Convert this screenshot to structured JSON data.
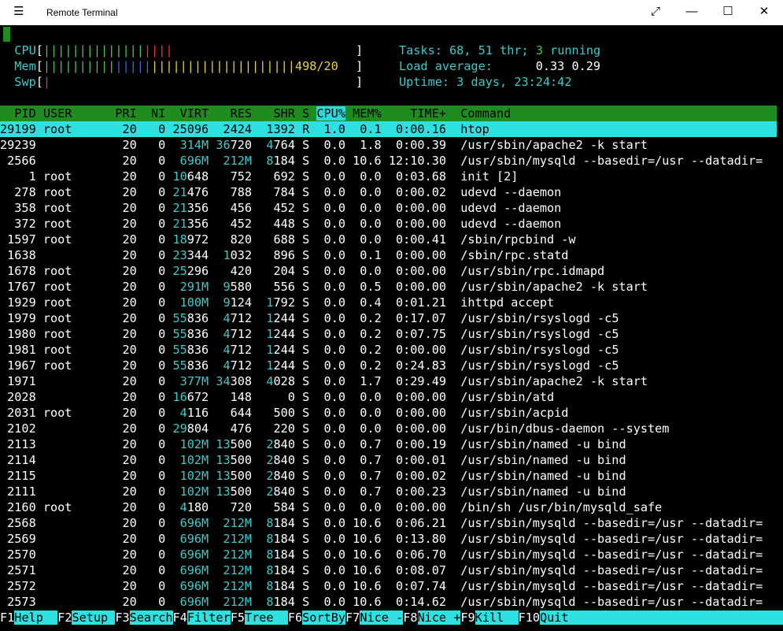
{
  "window": {
    "title": "Remote Terminal",
    "controls": [
      "⤢",
      "—",
      "☐",
      "✕"
    ]
  },
  "meters": {
    "cpu": {
      "label": "CPU",
      "green": "||||||||||||||",
      "red": "||||"
    },
    "mem": {
      "label": "Mem",
      "green": "||||||||||",
      "blue": "|||||",
      "yellow": "||||||||||||||||||||",
      "value": "498/20"
    },
    "swp": {
      "label": "Swp",
      "red": "|"
    }
  },
  "summary": {
    "tasks_label": "Tasks:",
    "tasks": "68,",
    "thr": "51",
    "thr_label": "thr;",
    "running": "3",
    "running_label": "running",
    "load_label": "Load average:",
    "load1": "0.33",
    "load5": "0.29",
    "uptime_label": "Uptime:",
    "uptime": "3 days, 23:24:42"
  },
  "columns": [
    "PID",
    "USER",
    "PRI",
    "NI",
    "VIRT",
    "RES",
    "SHR",
    "S",
    "CPU%",
    "MEM%",
    "TIME+",
    "Command"
  ],
  "processes": [
    {
      "pid": "29199",
      "user": "root",
      "pri": "20",
      "ni": "0",
      "virt": "25096",
      "res": "2424",
      "shr": "1392",
      "s": "R",
      "cpu": "1.0",
      "mem": "0.1",
      "time": "0:00.16",
      "cmd": "htop"
    },
    {
      "pid": "29239",
      "user": "",
      "pri": "20",
      "ni": "0",
      "virt": "314M",
      "res": "36720",
      "shr": "4764",
      "s": "S",
      "cpu": "0.0",
      "mem": "1.8",
      "time": "0:00.39",
      "cmd": "/usr/sbin/apache2 -k start"
    },
    {
      "pid": "2566",
      "user": "",
      "pri": "20",
      "ni": "0",
      "virt": "696M",
      "res": "212M",
      "shr": "8184",
      "s": "S",
      "cpu": "0.0",
      "mem": "10.6",
      "time": "12:10.30",
      "cmd": "/usr/sbin/mysqld --basedir=/usr --datadir="
    },
    {
      "pid": "1",
      "user": "root",
      "pri": "20",
      "ni": "0",
      "virt": "10648",
      "res": "752",
      "shr": "692",
      "s": "S",
      "cpu": "0.0",
      "mem": "0.0",
      "time": "0:03.68",
      "cmd": "init [2]"
    },
    {
      "pid": "278",
      "user": "root",
      "pri": "20",
      "ni": "0",
      "virt": "21476",
      "res": "788",
      "shr": "784",
      "s": "S",
      "cpu": "0.0",
      "mem": "0.0",
      "time": "0:00.02",
      "cmd": "udevd --daemon"
    },
    {
      "pid": "358",
      "user": "root",
      "pri": "20",
      "ni": "0",
      "virt": "21356",
      "res": "456",
      "shr": "452",
      "s": "S",
      "cpu": "0.0",
      "mem": "0.0",
      "time": "0:00.00",
      "cmd": "udevd --daemon"
    },
    {
      "pid": "372",
      "user": "root",
      "pri": "20",
      "ni": "0",
      "virt": "21356",
      "res": "452",
      "shr": "448",
      "s": "S",
      "cpu": "0.0",
      "mem": "0.0",
      "time": "0:00.00",
      "cmd": "udevd --daemon"
    },
    {
      "pid": "1597",
      "user": "root",
      "pri": "20",
      "ni": "0",
      "virt": "18972",
      "res": "820",
      "shr": "688",
      "s": "S",
      "cpu": "0.0",
      "mem": "0.0",
      "time": "0:00.41",
      "cmd": "/sbin/rpcbind -w"
    },
    {
      "pid": "1638",
      "user": "",
      "pri": "20",
      "ni": "0",
      "virt": "23344",
      "res": "1032",
      "shr": "896",
      "s": "S",
      "cpu": "0.0",
      "mem": "0.1",
      "time": "0:00.00",
      "cmd": "/sbin/rpc.statd"
    },
    {
      "pid": "1678",
      "user": "root",
      "pri": "20",
      "ni": "0",
      "virt": "25296",
      "res": "420",
      "shr": "204",
      "s": "S",
      "cpu": "0.0",
      "mem": "0.0",
      "time": "0:00.00",
      "cmd": "/usr/sbin/rpc.idmapd"
    },
    {
      "pid": "1767",
      "user": "root",
      "pri": "20",
      "ni": "0",
      "virt": "291M",
      "res": "9580",
      "shr": "556",
      "s": "S",
      "cpu": "0.0",
      "mem": "0.5",
      "time": "0:00.00",
      "cmd": "/usr/sbin/apache2 -k start"
    },
    {
      "pid": "1929",
      "user": "root",
      "pri": "20",
      "ni": "0",
      "virt": "100M",
      "res": "9124",
      "shr": "1792",
      "s": "S",
      "cpu": "0.0",
      "mem": "0.4",
      "time": "0:01.21",
      "cmd": "ihttpd accept"
    },
    {
      "pid": "1979",
      "user": "root",
      "pri": "20",
      "ni": "0",
      "virt": "55836",
      "res": "4712",
      "shr": "1244",
      "s": "S",
      "cpu": "0.0",
      "mem": "0.2",
      "time": "0:17.07",
      "cmd": "/usr/sbin/rsyslogd -c5"
    },
    {
      "pid": "1980",
      "user": "root",
      "pri": "20",
      "ni": "0",
      "virt": "55836",
      "res": "4712",
      "shr": "1244",
      "s": "S",
      "cpu": "0.0",
      "mem": "0.2",
      "time": "0:07.75",
      "cmd": "/usr/sbin/rsyslogd -c5"
    },
    {
      "pid": "1981",
      "user": "root",
      "pri": "20",
      "ni": "0",
      "virt": "55836",
      "res": "4712",
      "shr": "1244",
      "s": "S",
      "cpu": "0.0",
      "mem": "0.2",
      "time": "0:00.00",
      "cmd": "/usr/sbin/rsyslogd -c5"
    },
    {
      "pid": "1967",
      "user": "root",
      "pri": "20",
      "ni": "0",
      "virt": "55836",
      "res": "4712",
      "shr": "1244",
      "s": "S",
      "cpu": "0.0",
      "mem": "0.2",
      "time": "0:24.83",
      "cmd": "/usr/sbin/rsyslogd -c5"
    },
    {
      "pid": "1971",
      "user": "",
      "pri": "20",
      "ni": "0",
      "virt": "377M",
      "res": "34308",
      "shr": "4028",
      "s": "S",
      "cpu": "0.0",
      "mem": "1.7",
      "time": "0:29.49",
      "cmd": "/usr/sbin/apache2 -k start"
    },
    {
      "pid": "2028",
      "user": "",
      "pri": "20",
      "ni": "0",
      "virt": "16672",
      "res": "148",
      "shr": "0",
      "s": "S",
      "cpu": "0.0",
      "mem": "0.0",
      "time": "0:00.00",
      "cmd": "/usr/sbin/atd"
    },
    {
      "pid": "2031",
      "user": "root",
      "pri": "20",
      "ni": "0",
      "virt": "4116",
      "res": "644",
      "shr": "500",
      "s": "S",
      "cpu": "0.0",
      "mem": "0.0",
      "time": "0:00.00",
      "cmd": "/usr/sbin/acpid"
    },
    {
      "pid": "2102",
      "user": "",
      "pri": "20",
      "ni": "0",
      "virt": "29804",
      "res": "476",
      "shr": "220",
      "s": "S",
      "cpu": "0.0",
      "mem": "0.0",
      "time": "0:00.00",
      "cmd": "/usr/bin/dbus-daemon --system"
    },
    {
      "pid": "2113",
      "user": "",
      "pri": "20",
      "ni": "0",
      "virt": "102M",
      "res": "13500",
      "shr": "2840",
      "s": "S",
      "cpu": "0.0",
      "mem": "0.7",
      "time": "0:00.19",
      "cmd": "/usr/sbin/named -u bind"
    },
    {
      "pid": "2114",
      "user": "",
      "pri": "20",
      "ni": "0",
      "virt": "102M",
      "res": "13500",
      "shr": "2840",
      "s": "S",
      "cpu": "0.0",
      "mem": "0.7",
      "time": "0:00.01",
      "cmd": "/usr/sbin/named -u bind"
    },
    {
      "pid": "2115",
      "user": "",
      "pri": "20",
      "ni": "0",
      "virt": "102M",
      "res": "13500",
      "shr": "2840",
      "s": "S",
      "cpu": "0.0",
      "mem": "0.7",
      "time": "0:00.02",
      "cmd": "/usr/sbin/named -u bind"
    },
    {
      "pid": "2111",
      "user": "",
      "pri": "20",
      "ni": "0",
      "virt": "102M",
      "res": "13500",
      "shr": "2840",
      "s": "S",
      "cpu": "0.0",
      "mem": "0.7",
      "time": "0:00.23",
      "cmd": "/usr/sbin/named -u bind"
    },
    {
      "pid": "2160",
      "user": "root",
      "pri": "20",
      "ni": "0",
      "virt": "4180",
      "res": "720",
      "shr": "584",
      "s": "S",
      "cpu": "0.0",
      "mem": "0.0",
      "time": "0:00.00",
      "cmd": "/bin/sh /usr/bin/mysqld_safe"
    },
    {
      "pid": "2568",
      "user": "",
      "pri": "20",
      "ni": "0",
      "virt": "696M",
      "res": "212M",
      "shr": "8184",
      "s": "S",
      "cpu": "0.0",
      "mem": "10.6",
      "time": "0:06.21",
      "cmd": "/usr/sbin/mysqld --basedir=/usr --datadir="
    },
    {
      "pid": "2569",
      "user": "",
      "pri": "20",
      "ni": "0",
      "virt": "696M",
      "res": "212M",
      "shr": "8184",
      "s": "S",
      "cpu": "0.0",
      "mem": "10.6",
      "time": "0:13.80",
      "cmd": "/usr/sbin/mysqld --basedir=/usr --datadir="
    },
    {
      "pid": "2570",
      "user": "",
      "pri": "20",
      "ni": "0",
      "virt": "696M",
      "res": "212M",
      "shr": "8184",
      "s": "S",
      "cpu": "0.0",
      "mem": "10.6",
      "time": "0:06.70",
      "cmd": "/usr/sbin/mysqld --basedir=/usr --datadir="
    },
    {
      "pid": "2571",
      "user": "",
      "pri": "20",
      "ni": "0",
      "virt": "696M",
      "res": "212M",
      "shr": "8184",
      "s": "S",
      "cpu": "0.0",
      "mem": "10.6",
      "time": "0:08.07",
      "cmd": "/usr/sbin/mysqld --basedir=/usr --datadir="
    },
    {
      "pid": "2572",
      "user": "",
      "pri": "20",
      "ni": "0",
      "virt": "696M",
      "res": "212M",
      "shr": "8184",
      "s": "S",
      "cpu": "0.0",
      "mem": "10.6",
      "time": "0:07.74",
      "cmd": "/usr/sbin/mysqld --basedir=/usr --datadir="
    },
    {
      "pid": "2573",
      "user": "",
      "pri": "20",
      "ni": "0",
      "virt": "696M",
      "res": "212M",
      "shr": "8184",
      "s": "S",
      "cpu": "0.0",
      "mem": "10.6",
      "time": "0:14.62",
      "cmd": "/usr/sbin/mysqld --basedir=/usr --datadir="
    }
  ],
  "function_keys": [
    {
      "key": "F1",
      "label": "Help  "
    },
    {
      "key": "F2",
      "label": "Setup "
    },
    {
      "key": "F3",
      "label": "Search"
    },
    {
      "key": "F4",
      "label": "Filter"
    },
    {
      "key": "F5",
      "label": "Tree  "
    },
    {
      "key": "F6",
      "label": "SortBy"
    },
    {
      "key": "F7",
      "label": "Nice -"
    },
    {
      "key": "F8",
      "label": "Nice +"
    },
    {
      "key": "F9",
      "label": "Kill  "
    },
    {
      "key": "F10",
      "label": "Quit                                          "
    }
  ],
  "colors": {
    "accent_cyan": "#2ee0e0",
    "header_green": "#1e8c1e",
    "meter_green": "#4ec34e",
    "meter_red": "#e33",
    "meter_blue": "#3b6bdc",
    "meter_yellow": "#e6d33b"
  }
}
